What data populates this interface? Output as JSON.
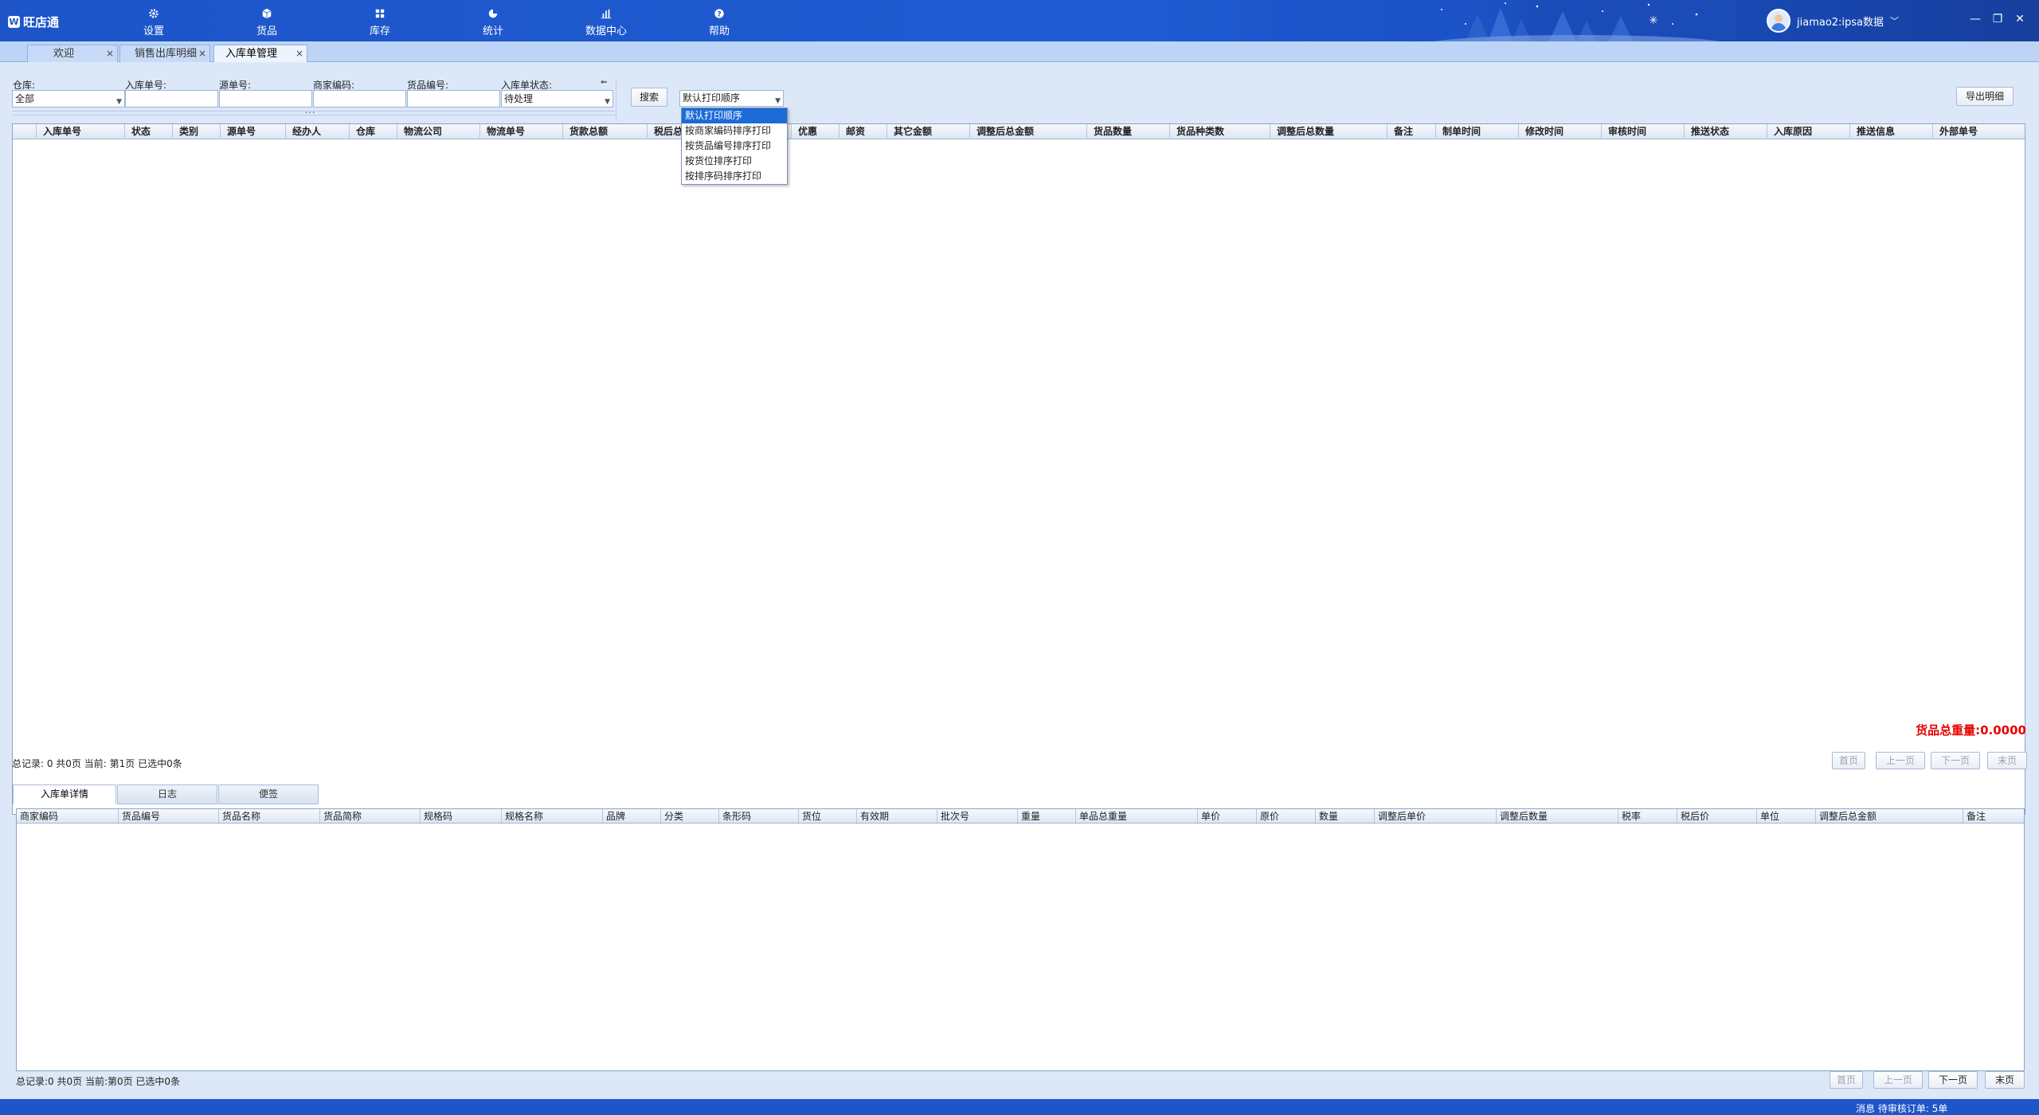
{
  "app": {
    "name": "旺店通",
    "logo_mark": "W"
  },
  "nav": [
    {
      "label": "设置",
      "icon": "gear-icon"
    },
    {
      "label": "货品",
      "icon": "box-icon"
    },
    {
      "label": "库存",
      "icon": "grid-icon"
    },
    {
      "label": "统计",
      "icon": "pie-chart-icon"
    },
    {
      "label": "数据中心",
      "icon": "bar-chart-icon"
    },
    {
      "label": "帮助",
      "icon": "question-icon"
    }
  ],
  "user": {
    "name": "jiamao2:ipsa数据",
    "dropdown_glyph": "﹀"
  },
  "window_controls": {
    "minimize": "—",
    "restore": "❐",
    "close": "✕"
  },
  "tabs": [
    {
      "label": "欢迎",
      "close": "×",
      "active": false
    },
    {
      "label": "销售出库明细",
      "close": "×",
      "active": false
    },
    {
      "label": "入库单管理",
      "close": "×",
      "active": true
    }
  ],
  "filters": {
    "warehouse_label": "仓库:",
    "warehouse_value": "全部",
    "inbound_no_label": "入库单号:",
    "inbound_no_value": "",
    "source_no_label": "源单号:",
    "source_no_value": "",
    "merchant_code_label": "商家编码:",
    "merchant_code_value": "",
    "goods_no_label": "货品编号:",
    "goods_no_value": "",
    "status_label": "入库单状态:",
    "status_value": "待处理",
    "collapse_glyph": "⇐",
    "dots": "..."
  },
  "toolbar": {
    "search_label": "搜索",
    "print_order_value": "默认打印顺序",
    "export_label": "导出明细"
  },
  "print_order_options": [
    "默认打印顺序",
    "按商家编码排序打印",
    "按货品编号排序打印",
    "按货位排序打印",
    "按排序码排序打印"
  ],
  "main_grid": {
    "columns": [
      "入库单号",
      "状态",
      "类别",
      "源单号",
      "经办人",
      "仓库",
      "物流公司",
      "物流单号",
      "货款总额",
      "税后总",
      "优惠",
      "邮资",
      "其它金额",
      "调整后总金额",
      "货品数量",
      "货品种类数",
      "调整后总数量",
      "备注",
      "制单时间",
      "修改时间",
      "审核时间",
      "推送状态",
      "入库原因",
      "推送信息",
      "外部单号"
    ],
    "rows": []
  },
  "main_pager": {
    "summary": "总记录: 0  共0页  当前: 第1页  已选中0条",
    "first": "首页",
    "prev": "上一页",
    "next": "下一页",
    "last": "末页"
  },
  "detail_tabs": [
    "入库单详情",
    "日志",
    "便签"
  ],
  "weight_text": "货品总重量:0.0000",
  "detail_grid": {
    "columns": [
      "商家编码",
      "货品编号",
      "货品名称",
      "货品简称",
      "规格码",
      "规格名称",
      "品牌",
      "分类",
      "条形码",
      "货位",
      "有效期",
      "批次号",
      "重量",
      "单品总重量",
      "单价",
      "原价",
      "数量",
      "调整后单价",
      "调整后数量",
      "税率",
      "税后价",
      "单位",
      "调整后总金额",
      "备注"
    ],
    "rows": []
  },
  "detail_pager": {
    "summary": "总记录:0  共0页  当前:第0页  已选中0条",
    "first": "首页",
    "prev": "上一页",
    "next": "下一页",
    "last": "末页"
  },
  "status_bar": {
    "message": "消息  待审核订单:   5单"
  },
  "colors": {
    "brand": "#1d55c9",
    "highlight": "#1c6bd6",
    "weight_text": "#e60000"
  }
}
